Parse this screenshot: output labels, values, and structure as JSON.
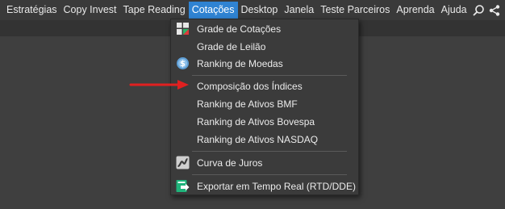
{
  "menubar": {
    "items": [
      {
        "label": "Estratégias"
      },
      {
        "label": "Copy Invest"
      },
      {
        "label": "Tape Reading"
      },
      {
        "label": "Cotações"
      },
      {
        "label": "Desktop"
      },
      {
        "label": "Janela"
      },
      {
        "label": "Teste Parceiros"
      },
      {
        "label": "Aprenda"
      },
      {
        "label": "Ajuda"
      }
    ],
    "active": "Cotações",
    "icons": [
      "search-icon",
      "share-icon"
    ]
  },
  "dropdown": {
    "items": [
      {
        "label": "Grade de Cotações",
        "icon": "grid-icon"
      },
      {
        "label": "Grade de Leilão",
        "icon": ""
      },
      {
        "label": "Ranking de Moedas",
        "icon": "coin-icon"
      },
      {
        "label": "Composição dos Índices",
        "icon": ""
      },
      {
        "label": "Ranking de Ativos BMF",
        "icon": ""
      },
      {
        "label": "Ranking de Ativos Bovespa",
        "icon": ""
      },
      {
        "label": "Ranking de Ativos NASDAQ",
        "icon": ""
      },
      {
        "label": "Curva de Juros",
        "icon": "curve-icon"
      },
      {
        "label": "Exportar em Tempo Real (RTD/DDE)",
        "icon": "export-icon"
      }
    ]
  },
  "colors": {
    "active_menu": "#2f83d2",
    "arrow": "#e02020",
    "export_icon": "#1fb37a"
  }
}
